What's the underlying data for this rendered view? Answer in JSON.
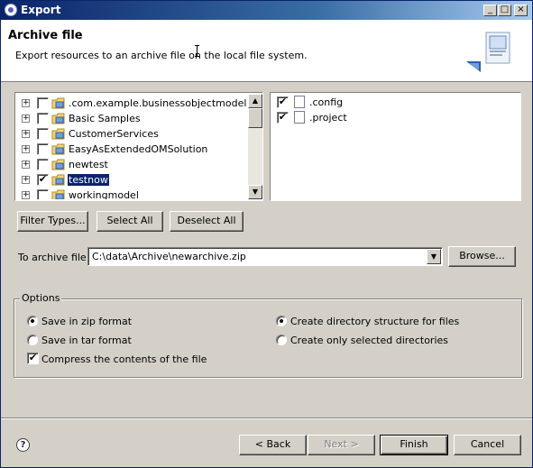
{
  "window": {
    "title": "Export",
    "controls": {
      "minimize": "_",
      "maximize": "□",
      "close": "×"
    }
  },
  "header": {
    "title": "Archive file",
    "description": "Export resources to an archive file on the local file system."
  },
  "projects": [
    {
      "label": ".com.example.businessobjectmodel",
      "checked": false,
      "selected": false,
      "expander": "+"
    },
    {
      "label": "Basic Samples",
      "checked": false,
      "selected": false,
      "expander": "+"
    },
    {
      "label": "CustomerServices",
      "checked": false,
      "selected": false,
      "expander": "+"
    },
    {
      "label": "EasyAsExtendedOMSolution",
      "checked": false,
      "selected": false,
      "expander": "+"
    },
    {
      "label": "newtest",
      "checked": false,
      "selected": false,
      "expander": "+"
    },
    {
      "label": "testnow",
      "checked": true,
      "selected": true,
      "expander": "+"
    },
    {
      "label": "workingmodel",
      "checked": false,
      "selected": false,
      "expander": "+"
    }
  ],
  "files": [
    {
      "label": ".config",
      "checked": true,
      "icon": "text-file-icon"
    },
    {
      "label": ".project",
      "checked": true,
      "icon": "xml-file-icon"
    }
  ],
  "selection_buttons": {
    "filter_types": "Filter Types...",
    "select_all": "Select All",
    "deselect_all": "Deselect All"
  },
  "archive": {
    "label": "To archive file:",
    "value": "C:\\data\\Archive\\newarchive.zip",
    "browse": "Browse..."
  },
  "options": {
    "title": "Options",
    "zip": {
      "label": "Save in zip format",
      "selected": true
    },
    "tar": {
      "label": "Save in tar format",
      "selected": false
    },
    "compress": {
      "label": "Compress the contents of the file",
      "checked": true
    },
    "create_dirs": {
      "label": "Create directory structure for files",
      "selected": true
    },
    "selected_dirs": {
      "label": "Create only selected directories",
      "selected": false
    }
  },
  "footer": {
    "help": "?",
    "back": "< Back",
    "next": "Next >",
    "finish": "Finish",
    "cancel": "Cancel"
  },
  "glyphs": {
    "check": "✔",
    "scroll_up": "▲",
    "scroll_down": "▼",
    "combo_drop": "▼"
  },
  "colors": {
    "selection": "#0a246a",
    "title_bar": "#0a246a",
    "dialog_bg": "#d4d0c8"
  }
}
